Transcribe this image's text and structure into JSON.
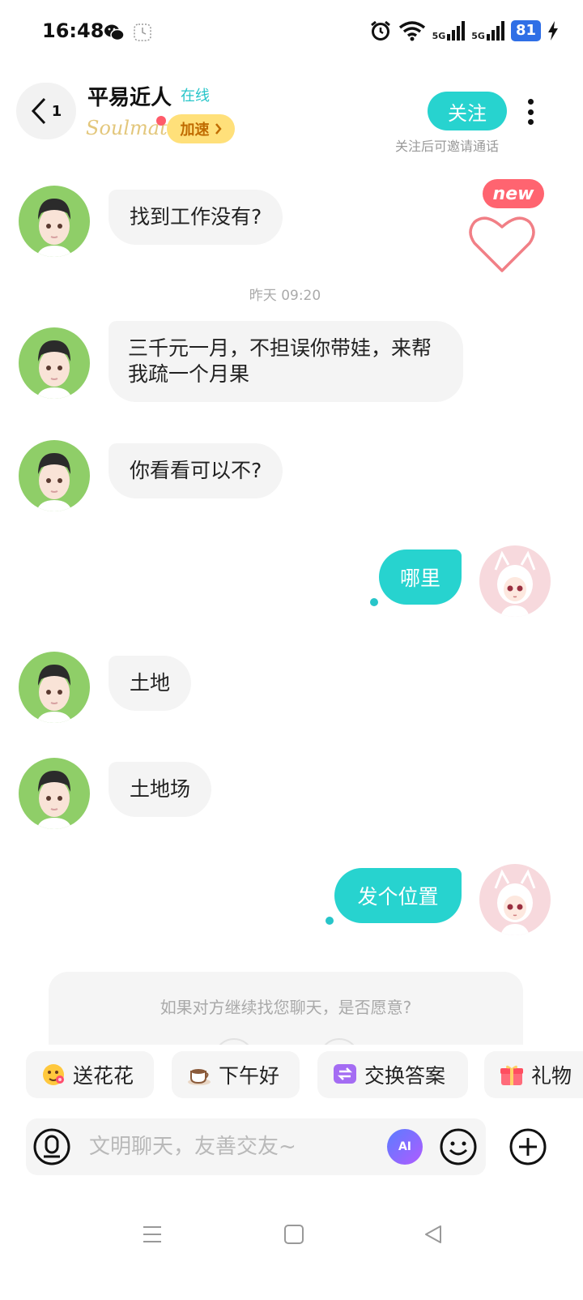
{
  "status_bar": {
    "time": "16:48",
    "network_1": "5G",
    "network_2": "5G",
    "battery": "81"
  },
  "header": {
    "back_count": "1",
    "name": "平易近人",
    "online_status": "在线",
    "logo_text": "Soulmate",
    "speed_label": "加速",
    "follow_label": "关注",
    "follow_hint": "关注后可邀请通话"
  },
  "floating": {
    "new_badge": "new"
  },
  "chat": {
    "timestamp": "昨天 09:20",
    "messages": [
      {
        "from": "peer",
        "text": "找到工作没有?"
      },
      {
        "from": "peer",
        "text": "三千元一月，不担误你带娃，来帮我疏一个月果"
      },
      {
        "from": "peer",
        "text": "你看看可以不?"
      },
      {
        "from": "me",
        "text": "哪里"
      },
      {
        "from": "peer",
        "text": "土地"
      },
      {
        "from": "peer",
        "text": "土地场"
      },
      {
        "from": "me",
        "text": "发个位置"
      }
    ],
    "prompt": "如果对方继续找您聊天，是否愿意?"
  },
  "quick_replies": [
    {
      "label": "送花花",
      "icon": "flower-emoji-icon"
    },
    {
      "label": "下午好",
      "icon": "coffee-icon"
    },
    {
      "label": "交换答案",
      "icon": "exchange-icon"
    },
    {
      "label": "礼物",
      "icon": "gift-icon"
    }
  ],
  "input": {
    "placeholder": "文明聊天，友善交友~",
    "ai_label": "AI"
  },
  "colors": {
    "accent": "#27d3cf",
    "bubble_in": "#f4f4f4",
    "new_badge": "#ff6470"
  }
}
